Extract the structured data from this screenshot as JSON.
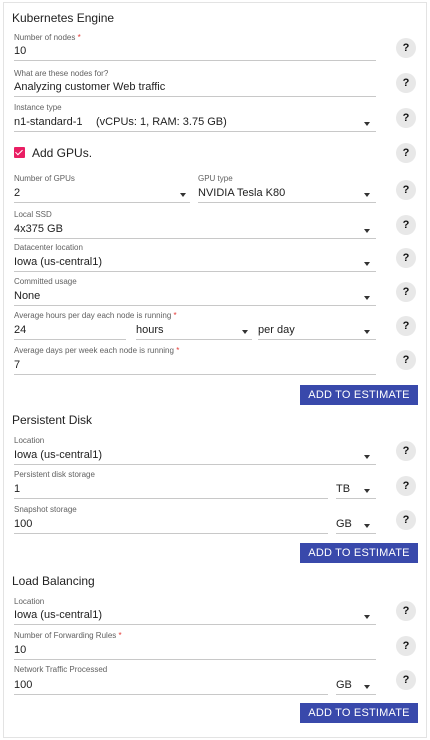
{
  "kubernetes": {
    "title": "Kubernetes Engine",
    "nodes_label": "Number of nodes",
    "required_mark": "*",
    "nodes_value": "10",
    "purpose_label": "What are these nodes for?",
    "purpose_value": "Analyzing customer Web traffic",
    "instance_label": "Instance type",
    "instance_value": "n1-standard-1",
    "instance_spec": "(vCPUs: 1, RAM: 3.75 GB)",
    "gpus_checkbox_label": "Add GPUs.",
    "gpus_count_label": "Number of GPUs",
    "gpus_count_value": "2",
    "gpu_type_label": "GPU type",
    "gpu_type_value": "NVIDIA Tesla K80",
    "ssd_label": "Local SSD",
    "ssd_value": "4x375 GB",
    "datacenter_label": "Datacenter location",
    "datacenter_value": "Iowa (us-central1)",
    "committed_label": "Committed usage",
    "committed_value": "None",
    "hours_label": "Average hours per day each node is running",
    "hours_value": "24",
    "hours_unit": "hours",
    "hours_period": "per day",
    "days_label": "Average days per week each node is running",
    "days_value": "7",
    "add_button": "ADD TO ESTIMATE"
  },
  "persistent_disk": {
    "title": "Persistent Disk",
    "location_label": "Location",
    "location_value": "Iowa (us-central1)",
    "storage_label": "Persistent disk storage",
    "storage_value": "1",
    "storage_unit": "TB",
    "snapshot_label": "Snapshot storage",
    "snapshot_value": "100",
    "snapshot_unit": "GB",
    "add_button": "ADD TO ESTIMATE"
  },
  "load_balancing": {
    "title": "Load Balancing",
    "location_label": "Location",
    "location_value": "Iowa (us-central1)",
    "rules_label": "Number of Forwarding Rules",
    "rules_value": "10",
    "traffic_label": "Network Traffic Processed",
    "traffic_value": "100",
    "traffic_unit": "GB",
    "add_button": "ADD TO ESTIMATE"
  },
  "help_glyph": "?",
  "colors": {
    "accent": "#3949ab",
    "checkbox": "#e91e63",
    "required": "#e53935"
  }
}
